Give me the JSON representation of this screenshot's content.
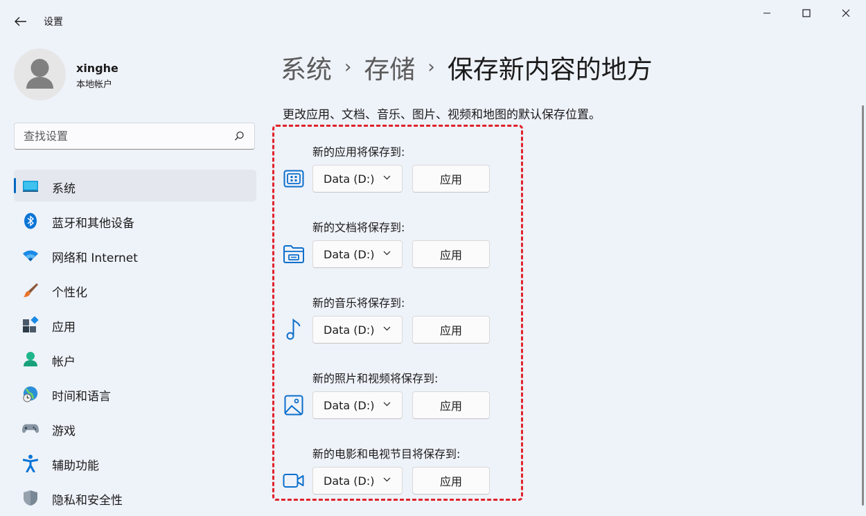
{
  "window": {
    "title": "设置",
    "controls": {
      "minimize": "minimize",
      "maximize": "maximize",
      "close": "close"
    }
  },
  "profile": {
    "name": "xinghe",
    "account_type": "本地帐户"
  },
  "search": {
    "placeholder": "查找设置"
  },
  "nav": {
    "items": [
      {
        "label": "系统",
        "icon": "system-icon",
        "selected": true
      },
      {
        "label": "蓝牙和其他设备",
        "icon": "bluetooth-icon"
      },
      {
        "label": "网络和 Internet",
        "icon": "wifi-icon"
      },
      {
        "label": "个性化",
        "icon": "brush-icon"
      },
      {
        "label": "应用",
        "icon": "apps-icon"
      },
      {
        "label": "帐户",
        "icon": "account-icon"
      },
      {
        "label": "时间和语言",
        "icon": "globe-clock-icon"
      },
      {
        "label": "游戏",
        "icon": "gamepad-icon"
      },
      {
        "label": "辅助功能",
        "icon": "accessibility-icon"
      },
      {
        "label": "隐私和安全性",
        "icon": "shield-icon"
      }
    ]
  },
  "header": {
    "breadcrumb": [
      "系统",
      "存储",
      "保存新内容的地方"
    ],
    "separator": "›",
    "description": "更改应用、文档、音乐、图片、视频和地图的默认保存位置。"
  },
  "save_locations": [
    {
      "label": "新的应用将保存到:",
      "drive": "Data (D:)",
      "apply": "应用",
      "icon": "app-grid-icon"
    },
    {
      "label": "新的文档将保存到:",
      "drive": "Data (D:)",
      "apply": "应用",
      "icon": "folder-doc-icon"
    },
    {
      "label": "新的音乐将保存到:",
      "drive": "Data (D:)",
      "apply": "应用",
      "icon": "music-note-icon"
    },
    {
      "label": "新的照片和视频将保存到:",
      "drive": "Data (D:)",
      "apply": "应用",
      "icon": "picture-icon"
    },
    {
      "label": "新的电影和电视节目将保存到:",
      "drive": "Data (D:)",
      "apply": "应用",
      "icon": "video-camera-icon"
    }
  ],
  "colors": {
    "accent": "#0067c0",
    "highlight_frame": "#e0222a",
    "background": "#eef2f9"
  }
}
